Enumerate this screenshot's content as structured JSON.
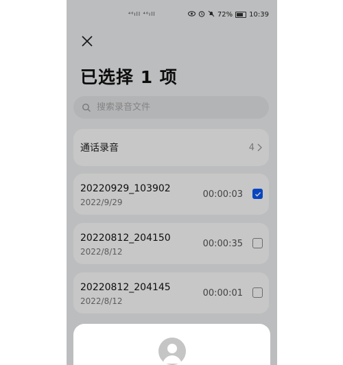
{
  "status_bar": {
    "signal": "⁴⁶ıll ⁴⁶ıll",
    "battery": "72%",
    "time": "10:39"
  },
  "header": {
    "title": "已选择 1 项"
  },
  "search": {
    "placeholder": "搜索录音文件"
  },
  "category": {
    "label": "通话录音",
    "count": "4"
  },
  "recordings": [
    {
      "name": "20220929_103902",
      "date": "2022/9/29",
      "duration": "00:00:03",
      "checked": true
    },
    {
      "name": "20220812_204150",
      "date": "2022/8/12",
      "duration": "00:00:35",
      "checked": false
    },
    {
      "name": "20220812_204145",
      "date": "2022/8/12",
      "duration": "00:00:01",
      "checked": false
    }
  ],
  "colors": {
    "accent": "#0a59f7",
    "background": "#f1f2f4"
  }
}
